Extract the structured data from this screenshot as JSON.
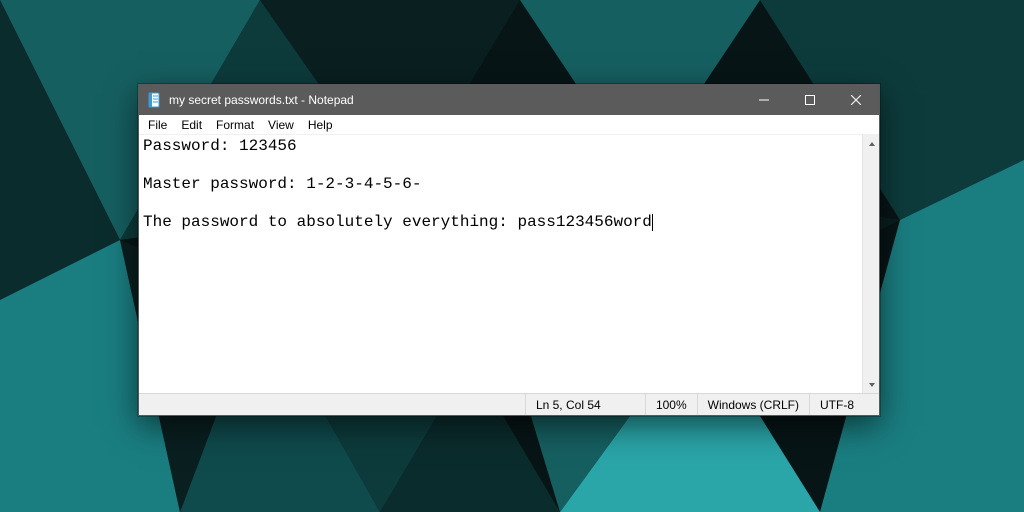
{
  "titlebar": {
    "title": "my secret passwords.txt - Notepad"
  },
  "menubar": {
    "file": "File",
    "edit": "Edit",
    "format": "Format",
    "view": "View",
    "help": "Help"
  },
  "document": {
    "line1": "Password: 123456",
    "line2": "",
    "line3": "Master password: 1-2-3-4-5-6-",
    "line4": "",
    "line5": "The password to absolutely everything: pass123456word"
  },
  "statusbar": {
    "cursor": "Ln 5, Col 54",
    "zoom": "100%",
    "line_ending": "Windows (CRLF)",
    "encoding": "UTF-8"
  }
}
